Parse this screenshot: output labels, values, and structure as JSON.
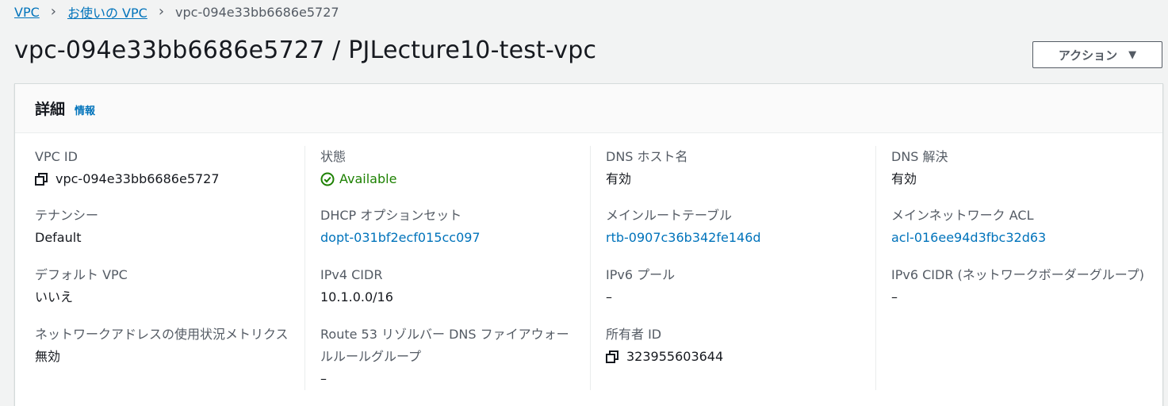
{
  "breadcrumb": {
    "items": [
      "VPC",
      "お使いの VPC"
    ],
    "current": "vpc-094e33bb6686e5727"
  },
  "page": {
    "title": "vpc-094e33bb6686e5727 / PJLecture10-test-vpc",
    "action_label": "アクション"
  },
  "panel": {
    "title": "詳細",
    "info_link": "情報"
  },
  "fields": {
    "vpc_id": {
      "label": "VPC ID",
      "value": "vpc-094e33bb6686e5727"
    },
    "tenancy": {
      "label": "テナンシー",
      "value": "Default"
    },
    "default_vpc": {
      "label": "デフォルト VPC",
      "value": "いいえ"
    },
    "network_metrics": {
      "label": "ネットワークアドレスの使用状況メトリクス",
      "value": "無効"
    },
    "state": {
      "label": "状態",
      "value": "Available"
    },
    "dhcp": {
      "label": "DHCP オプションセット",
      "value": "dopt-031bf2ecf015cc097"
    },
    "ipv4_cidr": {
      "label": "IPv4 CIDR",
      "value": "10.1.0.0/16"
    },
    "route53": {
      "label": "Route 53 リゾルバー DNS ファイアウォールルールグループ",
      "value": "–"
    },
    "dns_hostnames": {
      "label": "DNS ホスト名",
      "value": "有効"
    },
    "main_route_table": {
      "label": "メインルートテーブル",
      "value": "rtb-0907c36b342fe146d"
    },
    "ipv6_pool": {
      "label": "IPv6 プール",
      "value": "–"
    },
    "owner_id": {
      "label": "所有者 ID",
      "value": "323955603644"
    },
    "dns_resolution": {
      "label": "DNS 解決",
      "value": "有効"
    },
    "main_acl": {
      "label": "メインネットワーク ACL",
      "value": "acl-016ee94d3fbc32d63"
    },
    "ipv6_cidr_border": {
      "label": "IPv6 CIDR (ネットワークボーダーグループ)",
      "value": "–"
    }
  },
  "colors": {
    "link": "#0073bb",
    "success": "#1d8102"
  },
  "icons": {
    "copy": "copy-icon",
    "status": "check-circle-icon",
    "action": "caret-down-icon"
  }
}
